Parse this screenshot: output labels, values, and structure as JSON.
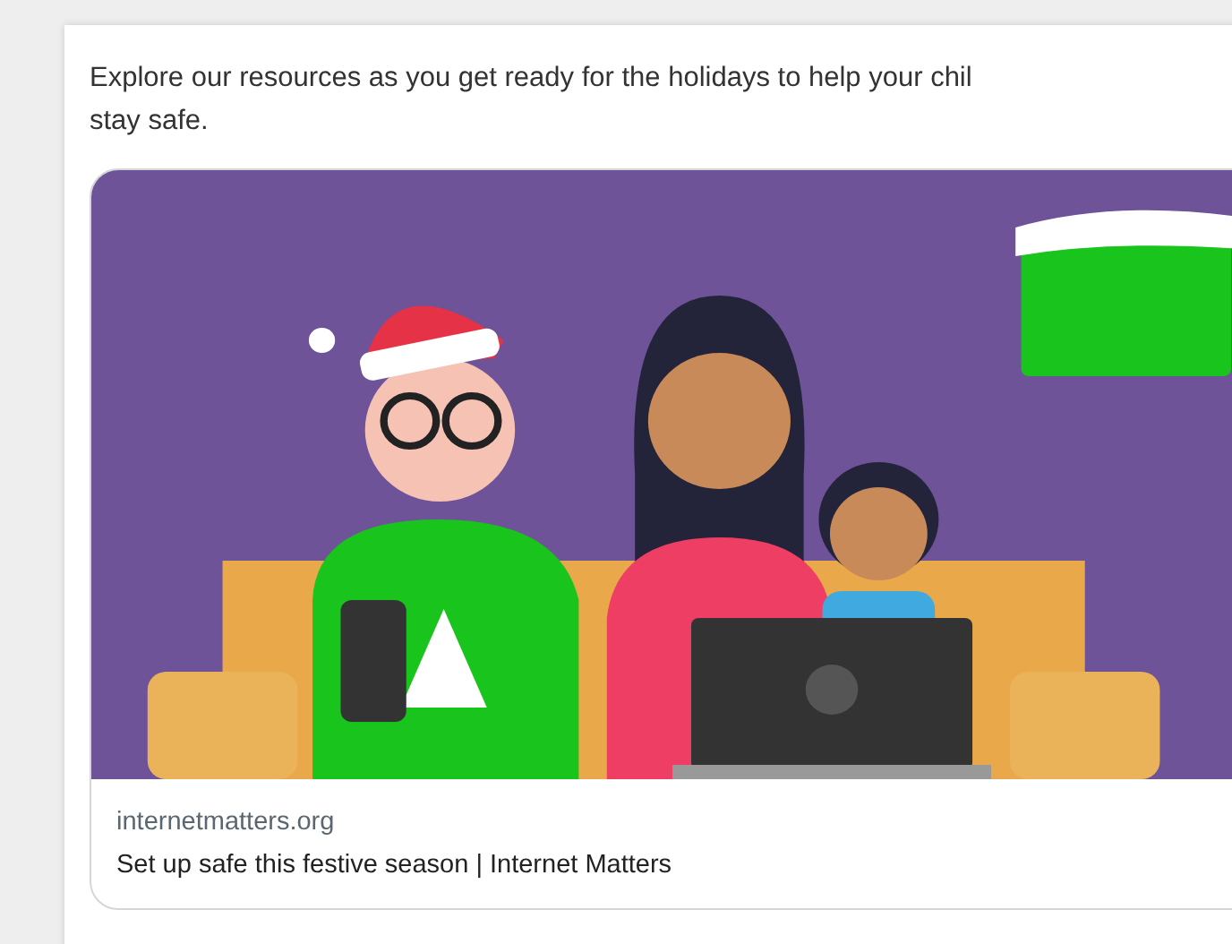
{
  "post": {
    "text": "Explore our resources as you get ready for the holidays to help your chil\nstay safe."
  },
  "link_card": {
    "domain": "internetmatters.org",
    "title": "Set up safe this festive season | Internet Matters"
  }
}
